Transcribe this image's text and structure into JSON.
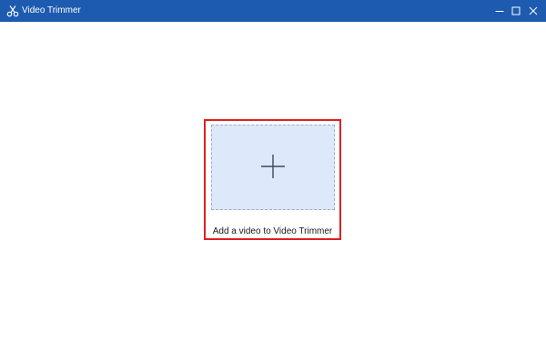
{
  "window": {
    "title": "Video Trimmer",
    "app_icon": "scissors-icon",
    "titlebar_color": "#1d5bb0",
    "controls": {
      "minimize_icon": "minimize-icon",
      "maximize_icon": "maximize-icon",
      "close_icon": "close-icon"
    }
  },
  "main": {
    "drop_zone": {
      "icon": "plus-icon",
      "fill_color": "#dde9fb",
      "label": "Add a video to Video Trimmer"
    },
    "highlight_color": "#e0201f"
  }
}
